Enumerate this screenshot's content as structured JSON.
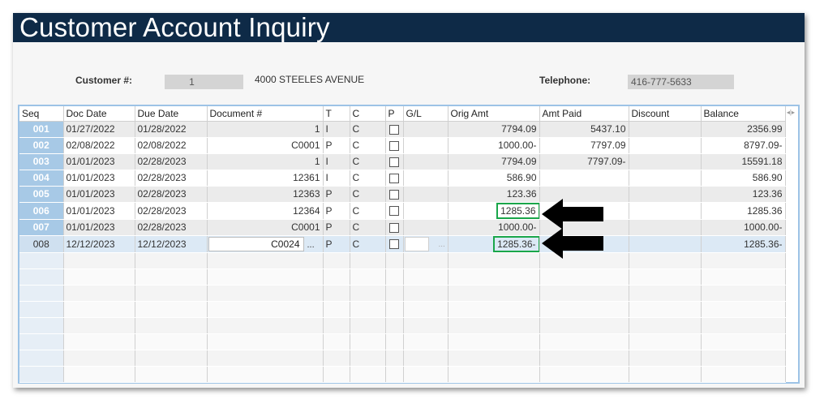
{
  "window": {
    "title": "Customer Account Inquiry"
  },
  "header": {
    "customer_label": "Customer #:",
    "customer_value": "1",
    "address": "4000 STEELES AVENUE",
    "telephone_label": "Telephone:",
    "telephone_value": "416-777-5633"
  },
  "grid": {
    "columns": [
      "Seq",
      "Doc Date",
      "Due Date",
      "Document #",
      "T",
      "C",
      "P",
      "G/L",
      "Orig Amt",
      "Amt Paid",
      "Discount",
      "Balance"
    ],
    "rows": [
      {
        "seq": "001",
        "doc_date": "01/27/2022",
        "due_date": "01/28/2022",
        "doc": "1",
        "t": "I",
        "c": "C",
        "gl": "",
        "orig": "7794.09",
        "paid": "5437.10",
        "disc": "",
        "bal": "2356.99"
      },
      {
        "seq": "002",
        "doc_date": "02/08/2022",
        "due_date": "02/08/2022",
        "doc": "C0001",
        "t": "P",
        "c": "C",
        "gl": "",
        "orig": "1000.00-",
        "paid": "7797.09",
        "disc": "",
        "bal": "8797.09-"
      },
      {
        "seq": "003",
        "doc_date": "01/01/2023",
        "due_date": "02/28/2023",
        "doc": "1",
        "t": "I",
        "c": "C",
        "gl": "",
        "orig": "7794.09",
        "paid": "7797.09-",
        "disc": "",
        "bal": "15591.18"
      },
      {
        "seq": "004",
        "doc_date": "01/01/2023",
        "due_date": "02/28/2023",
        "doc": "12361",
        "t": "I",
        "c": "C",
        "gl": "",
        "orig": "586.90",
        "paid": "",
        "disc": "",
        "bal": "586.90"
      },
      {
        "seq": "005",
        "doc_date": "01/01/2023",
        "due_date": "02/28/2023",
        "doc": "12363",
        "t": "P",
        "c": "C",
        "gl": "",
        "orig": "123.36",
        "paid": "",
        "disc": "",
        "bal": "123.36"
      },
      {
        "seq": "006",
        "doc_date": "01/01/2023",
        "due_date": "02/28/2023",
        "doc": "12364",
        "t": "P",
        "c": "C",
        "gl": "",
        "orig": "1285.36",
        "paid": "",
        "disc": "",
        "bal": "1285.36"
      },
      {
        "seq": "007",
        "doc_date": "01/01/2023",
        "due_date": "02/28/2023",
        "doc": "C0001",
        "t": "P",
        "c": "C",
        "gl": "",
        "orig": "1000.00-",
        "paid": "",
        "disc": "",
        "bal": "1000.00-"
      },
      {
        "seq": "008",
        "doc_date": "12/12/2023",
        "due_date": "12/12/2023",
        "doc": "C0024",
        "t": "P",
        "c": "C",
        "gl": "",
        "orig": "1285.36-",
        "paid": "",
        "disc": "",
        "bal": "1285.36-"
      }
    ],
    "ellipsis": "...",
    "gl_ellipsis": "...",
    "empty_rows": 8
  },
  "colors": {
    "title_bar": "#0e2a47",
    "seq_cell": "#a7c9e6",
    "highlight": "#1aa64a",
    "grid_border": "#9dc3e6"
  },
  "icons": {
    "column_scroll": "column-scroll-arrows-icon",
    "annotation": "arrow-left-icon"
  }
}
